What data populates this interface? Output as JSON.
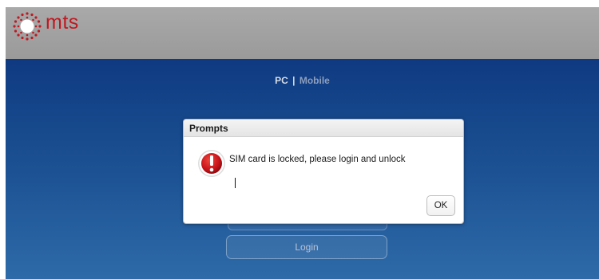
{
  "header": {
    "logo_text": "mts"
  },
  "view_switch": {
    "pc_label": "PC",
    "separator": "|",
    "mobile_label": "Mobile"
  },
  "login": {
    "button_label": "Login"
  },
  "dialog": {
    "title": "Prompts",
    "message": "SIM card is locked, please login and unlock",
    "ok_label": "OK",
    "icon": "alert-icon"
  },
  "colors": {
    "brand_red": "#c21820",
    "main_bg_top": "#0f3a82",
    "main_bg_bottom": "#2e6aa8",
    "header_bg": "#a9a9a9"
  }
}
